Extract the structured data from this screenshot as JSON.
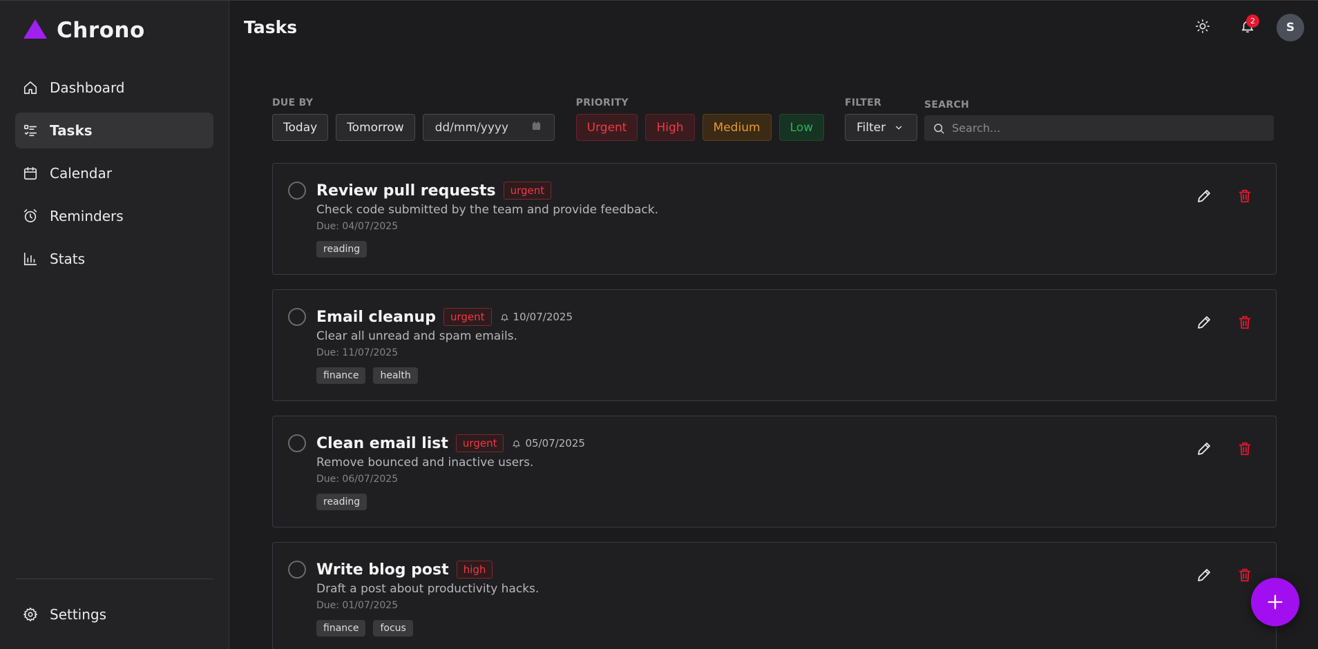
{
  "app": {
    "name": "Chrono",
    "brand_color": "#a020f0"
  },
  "sidebar": {
    "items": [
      {
        "label": "Dashboard",
        "icon": "home-icon",
        "active": false
      },
      {
        "label": "Tasks",
        "icon": "tasks-list-icon",
        "active": true
      },
      {
        "label": "Calendar",
        "icon": "calendar-icon",
        "active": false
      },
      {
        "label": "Reminders",
        "icon": "alarm-clock-icon",
        "active": false
      },
      {
        "label": "Stats",
        "icon": "bar-chart-icon",
        "active": false
      }
    ],
    "settings_label": "Settings"
  },
  "header": {
    "title": "Tasks",
    "notification_count": "2",
    "avatar_initial": "S"
  },
  "filters": {
    "due_by_label": "DUE BY",
    "today_label": "Today",
    "tomorrow_label": "Tomorrow",
    "date_placeholder": "dd/mm/yyyy",
    "priority_label": "PRIORITY",
    "priorities": [
      "Urgent",
      "High",
      "Medium",
      "Low"
    ],
    "filter_label": "FILTER",
    "filter_value": "Filter",
    "search_label": "SEARCH",
    "search_placeholder": "Search..."
  },
  "tasks": [
    {
      "title": "Review pull requests",
      "priority": "urgent",
      "reminder": "",
      "description": "Check code submitted by the team and provide feedback.",
      "due": "Due: 04/07/2025",
      "tags": [
        "reading"
      ]
    },
    {
      "title": "Email cleanup",
      "priority": "urgent",
      "reminder": "10/07/2025",
      "description": "Clear all unread and spam emails.",
      "due": "Due: 11/07/2025",
      "tags": [
        "finance",
        "health"
      ]
    },
    {
      "title": "Clean email list",
      "priority": "urgent",
      "reminder": "05/07/2025",
      "description": "Remove bounced and inactive users.",
      "due": "Due: 06/07/2025",
      "tags": [
        "reading"
      ]
    },
    {
      "title": "Write blog post",
      "priority": "high",
      "reminder": "",
      "description": "Draft a post about productivity hacks.",
      "due": "Due: 01/07/2025",
      "tags": [
        "finance",
        "focus"
      ]
    }
  ],
  "colors": {
    "accent": "#a10ff0",
    "danger": "#e5182f",
    "medium": "#e89a2d",
    "low": "#26b55a"
  }
}
